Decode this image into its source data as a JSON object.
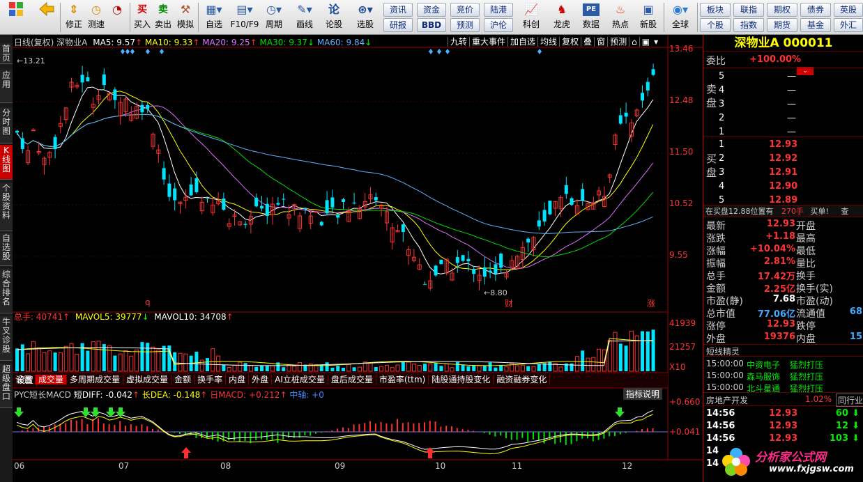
{
  "toolbar": {
    "items": [
      {
        "label": "",
        "icon": "windows-icon"
      },
      {
        "label": "",
        "icon": "back-arrow-icon"
      },
      {
        "label": "修正",
        "icon": "up-down-arrow-icon"
      },
      {
        "label": "测速",
        "icon": "clock-icon"
      },
      {
        "label": "买入",
        "icon": "buy-icon",
        "glyph": "买"
      },
      {
        "label": "卖出",
        "icon": "sell-icon",
        "glyph": "卖"
      },
      {
        "label": "模拟",
        "icon": "hammer-icon"
      },
      {
        "label": "自选",
        "icon": "watchlist-icon"
      },
      {
        "label": "F10/F9",
        "icon": "f10-icon"
      },
      {
        "label": "周期",
        "icon": "period-icon"
      },
      {
        "label": "画线",
        "icon": "pencil-icon"
      },
      {
        "label": "论股",
        "icon": "discuss-icon",
        "glyph": "论"
      },
      {
        "label": "选股",
        "icon": "stock-pick-icon"
      },
      {
        "label": "科创",
        "icon": "kechuang-icon"
      },
      {
        "label": "龙虎",
        "icon": "dragon-tiger-icon"
      },
      {
        "label": "数据",
        "icon": "pe-data-icon",
        "glyph": "PE"
      },
      {
        "label": "热点",
        "icon": "hot-icon"
      },
      {
        "label": "新股",
        "icon": "ipo-icon"
      },
      {
        "label": "全球",
        "icon": "globe-icon"
      }
    ],
    "row1": [
      "资讯",
      "资金",
      "竞价",
      "陆港"
    ],
    "row2": [
      "研报",
      "BBD",
      "预测",
      "沪伦"
    ],
    "row1b": [
      "板块",
      "联指",
      "期权",
      "债券",
      "英股"
    ],
    "row2b": [
      "个股",
      "指数",
      "期货",
      "基金",
      "外汇"
    ]
  },
  "left_tabs": [
    "首\n页",
    "应\n用",
    "分\n时\n图",
    "K\n线\n图",
    "个\n股\n资\n料",
    "自\n选\n股",
    "综\n合\n排\n名",
    "牛\n叉\n诊\n股",
    "超\n级\n盘\n口"
  ],
  "kline": {
    "header": "日线(复权)  深物业A",
    "ma5": "MA5: 9.57",
    "ma10": "MA10: 9.33",
    "ma20": "MA20: 9.25",
    "ma30": "MA30: 9.37",
    "ma60": "MA60: 9.84",
    "buttons": [
      "九转",
      "重大事件",
      "加自选",
      "均线",
      "复权",
      "叠",
      "窗",
      "预测"
    ],
    "price_axis": [
      "13.46",
      "12.48",
      "11.50",
      "10.52",
      "9.55"
    ],
    "high_label": "13.21",
    "low_label": "8.80",
    "markers": [
      "q",
      "财",
      "涨"
    ]
  },
  "volume": {
    "header": "总手: 40741",
    "mavol5": "MAVOL5: 39777",
    "mavol10": "MAVOL10: 34708",
    "axis": [
      "41939",
      "21257",
      "X10"
    ]
  },
  "bottom_tabs": [
    "设置",
    "成交量",
    "多周期成交量",
    "虚拟成交量",
    "金额",
    "换手率",
    "内盘",
    "外盘",
    "AI立桩成交量",
    "盘后成交量",
    "市盈率(ttm)",
    "陆股通持股变化",
    "融资融券变化"
  ],
  "macd": {
    "header": "PYC短长MACD",
    "diff": "短DIFF: -0.042",
    "dea": "长DEA: -0.148",
    "rmacd": "日MACD: +0.212",
    "zero": "中轴: +0",
    "help": "指标说明",
    "axis": [
      "+0.660",
      "+0.041"
    ]
  },
  "months": [
    "06",
    "07",
    "08",
    "09",
    "10",
    "11",
    "12"
  ],
  "quote": {
    "title": "深物业A 000011",
    "weibi_label": "委比",
    "weibi": "+100.00%",
    "sell_label": "卖\n盘",
    "buy_label": "买\n盘",
    "sell": [
      {
        "n": "5",
        "p": "",
        "v": "—"
      },
      {
        "n": "4",
        "p": "",
        "v": "—"
      },
      {
        "n": "3",
        "p": "",
        "v": "—"
      },
      {
        "n": "2",
        "p": "",
        "v": "—"
      },
      {
        "n": "1",
        "p": "",
        "v": "—"
      }
    ],
    "buy": [
      {
        "n": "1",
        "p": "12.93"
      },
      {
        "n": "2",
        "p": "12.92"
      },
      {
        "n": "3",
        "p": "12.91"
      },
      {
        "n": "4",
        "p": "12.90"
      },
      {
        "n": "5",
        "p": "12.89"
      }
    ],
    "notice_a": "在买盘12.88位置有",
    "notice_b": "270手",
    "notice_c": "买单!",
    "notice_d": "查",
    "stats": [
      [
        "最新",
        "12.93",
        "开盘",
        ""
      ],
      [
        "涨跌",
        "+1.18",
        "最高",
        ""
      ],
      [
        "涨幅",
        "+10.04%",
        "最低",
        ""
      ],
      [
        "振幅",
        "2.81%",
        "量比",
        ""
      ],
      [
        "总手",
        "17.42万",
        "换手",
        ""
      ],
      [
        "金额",
        "2.25亿",
        "换手(实)",
        ""
      ],
      [
        "市盈(静)",
        "7.68",
        "市盈(动)",
        ""
      ],
      [
        "总市值",
        "77.06亿",
        "流通值",
        "68"
      ],
      [
        "涨停",
        "12.93",
        "跌停",
        ""
      ],
      [
        "外盘",
        "19376",
        "内盘",
        "15"
      ]
    ],
    "jingling_title": "短线精灵",
    "jingling": [
      [
        "15:00:00",
        "中资电子",
        "猛烈打压"
      ],
      [
        "15:00:00",
        "森马服饰",
        "猛烈打压"
      ],
      [
        "15:00:00",
        "北斗星通",
        "猛烈打压"
      ]
    ],
    "sector": "房地产开发",
    "sector_pct": "1.02%",
    "sector_btn": "同行业",
    "ticks": [
      [
        "14:56",
        "12.93",
        "60"
      ],
      [
        "14:56",
        "12.93",
        "12"
      ],
      [
        "14:56",
        "12.93",
        "103"
      ],
      [
        "14",
        "",
        " "
      ],
      [
        "14",
        "",
        " "
      ]
    ],
    "watermark": "分析家公式网",
    "watermark_url": "www.fxjgsw.com"
  },
  "colors": {
    "up": "#ff3232",
    "down": "#00e4ff",
    "ma5": "#ffffff",
    "ma10": "#ffff00",
    "ma20": "#e070ff",
    "ma30": "#00dd00",
    "ma60": "#5fb0ff"
  }
}
